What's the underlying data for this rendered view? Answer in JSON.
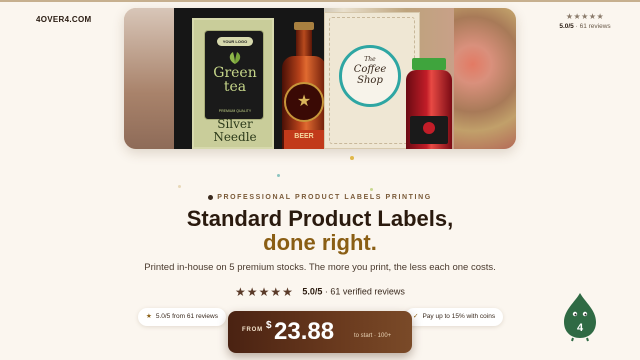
{
  "brand": {
    "logo": "4OVER4.COM"
  },
  "top_rating": {
    "stars": "★★★★★",
    "score": "5.0/5",
    "reviews": "· 61 reviews"
  },
  "hero": {
    "tea_logo": "YOUR LOGO",
    "tea_name_1": "Green",
    "tea_name_2": "tea",
    "tea_premium": "PREMIUM QUALITY",
    "tea_variant_1": "Silver",
    "tea_variant_2": "Needle",
    "beer_label": "BEER",
    "coffee_1": "The",
    "coffee_2": "Coffee",
    "coffee_3": "Shop"
  },
  "eyebrow": "PROFESSIONAL PRODUCT LABELS PRINTING",
  "headline_line1": "Standard Product Labels,",
  "headline_line2": "done right.",
  "subheadline": "Printed in-house on 5 premium stocks. The more you print, the less each one costs.",
  "rating": {
    "stars": "★★★★★",
    "score": "5.0/5",
    "text": "· 61 verified reviews"
  },
  "chips": {
    "left": {
      "icon": "★",
      "text": "5.0/5 from 61 reviews"
    },
    "right": {
      "icon": "✓",
      "text": "Pay up to 15% with coins"
    }
  },
  "price": {
    "from": "FROM",
    "currency": "$",
    "amount": "23.88",
    "tail": "to start · 100+"
  },
  "mascot": {
    "label": "4"
  },
  "colors": {
    "accent": "#8a5e14",
    "button": "#5a2e18",
    "background": "#fbf6ef"
  }
}
